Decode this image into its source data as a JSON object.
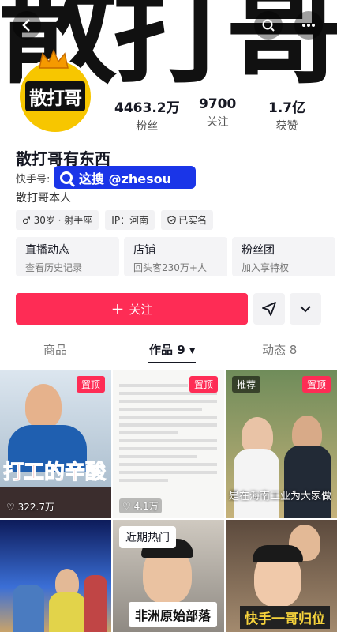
{
  "banner": {
    "text": "散打哥"
  },
  "profile": {
    "avatar_text": "散打哥",
    "name": "散打哥有东西",
    "kuaishou_label": "快手号:",
    "search_tag": "这搜 @zhesou",
    "bio": "散打哥本人",
    "tags": [
      "♂ 30岁 · 射手座",
      "IP：河南",
      "已实名"
    ]
  },
  "stats": [
    {
      "value": "4463.2万",
      "label": "粉丝"
    },
    {
      "value": "9700",
      "label": "关注"
    },
    {
      "value": "1.7亿",
      "label": "获赞"
    }
  ],
  "cards": [
    {
      "title": "直播动态",
      "sub": "查看历史记录"
    },
    {
      "title": "店铺",
      "sub": "回头客230万+人"
    },
    {
      "title": "粉丝团",
      "sub": "加入享特权"
    }
  ],
  "actions": {
    "follow_label": "关注"
  },
  "tabs": [
    {
      "label": "商品"
    },
    {
      "label": "作品 9 ▾"
    },
    {
      "label": "动态 8"
    }
  ],
  "videos": [
    {
      "badge": "置顶",
      "caption": "打工的辛酸",
      "likes": "322.7万"
    },
    {
      "badge": "置顶",
      "likes": "4.1万"
    },
    {
      "badge": "置顶",
      "rec": "推荐",
      "caption": "是在海南工业为大家做"
    },
    {
      "caption": ""
    },
    {
      "hot": "近期热门",
      "caption": "非洲原始部落"
    },
    {
      "caption": "快手一哥归位"
    }
  ],
  "colors": {
    "accent": "#fe2c55",
    "search_tag_bg": "#1a35e8"
  }
}
